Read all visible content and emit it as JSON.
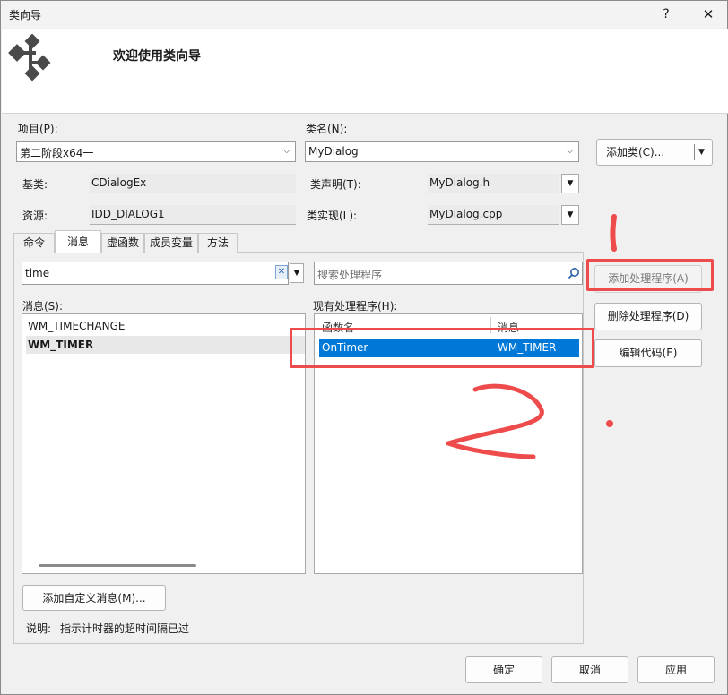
{
  "window": {
    "title": "类向导",
    "help_label": "?",
    "close_label": "✕"
  },
  "header": {
    "title": "欢迎使用类向导",
    "logo_icon": "class-wizard-icon"
  },
  "fields": {
    "project_label": "项目(P):",
    "project_value": "第二阶段x64一",
    "classname_label": "类名(N):",
    "classname_value": "MyDialog",
    "add_class_label": "添加类(C)...",
    "base_label": "基类:",
    "base_value": "CDialogEx",
    "decl_label": "类声明(T):",
    "decl_value": "MyDialog.h",
    "resource_label": "资源:",
    "resource_value": "IDD_DIALOG1",
    "impl_label": "类实现(L):",
    "impl_value": "MyDialog.cpp"
  },
  "tabs": [
    {
      "label": "命令"
    },
    {
      "label": "消息"
    },
    {
      "label": "虚函数"
    },
    {
      "label": "成员变量"
    },
    {
      "label": "方法"
    }
  ],
  "messages_panel": {
    "search_value": "time",
    "label": "消息(S):",
    "items": [
      "WM_TIMECHANGE",
      "WM_TIMER"
    ]
  },
  "handlers_panel": {
    "search_placeholder": "搜索处理程序",
    "label": "现有处理程序(H):",
    "col_function": "函数名",
    "col_message": "消息",
    "rows": [
      {
        "function": "OnTimer",
        "message": "WM_TIMER"
      }
    ]
  },
  "buttons": {
    "add_handler": "添加处理程序(A)",
    "delete_handler": "删除处理程序(D)",
    "edit_code": "编辑代码(E)",
    "add_custom_message": "添加自定义消息(M)...",
    "ok": "确定",
    "cancel": "取消",
    "apply": "应用"
  },
  "description": {
    "label": "说明:",
    "text": "指示计时器的超时间隔已过"
  },
  "annotations": {
    "color": "#ee4c4c"
  }
}
